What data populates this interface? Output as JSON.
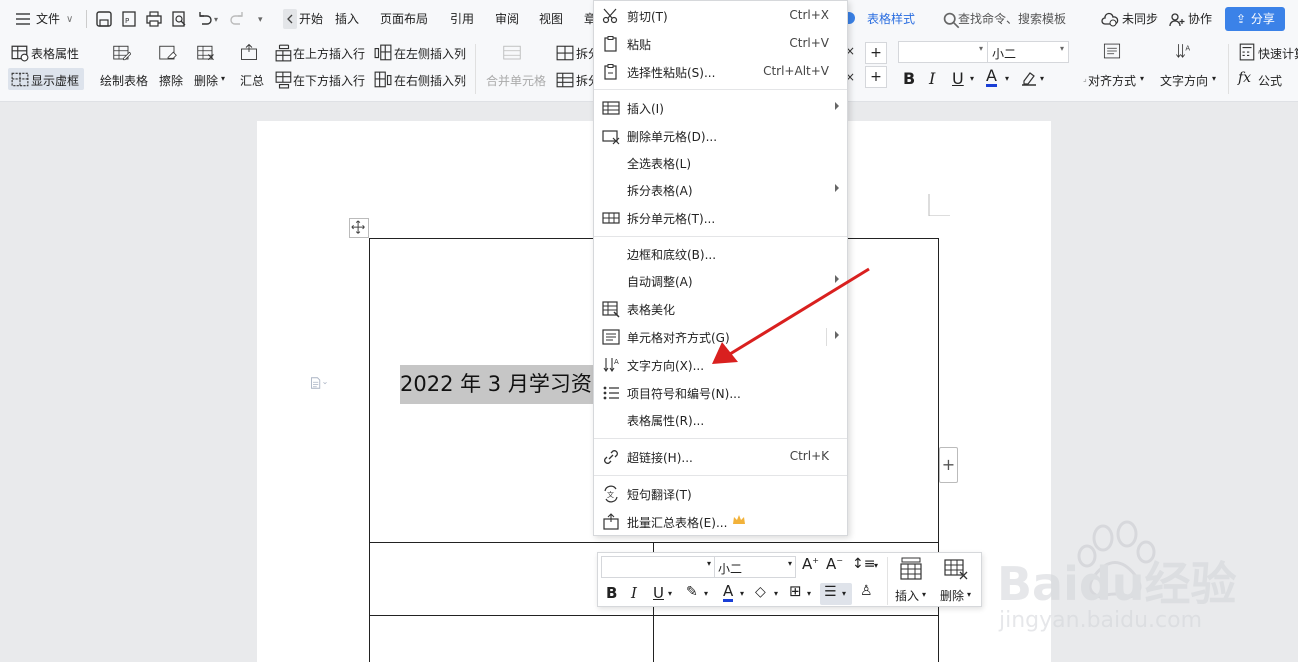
{
  "topbar": {
    "file_label": "文件",
    "tabs": [
      "开始",
      "插入",
      "页面布局",
      "引用",
      "审阅",
      "视图",
      "章"
    ],
    "active_tab": "表格样式",
    "search_placeholder": "查找命令、搜索模板",
    "sync_label": "未同步",
    "collab_label": "协作",
    "share_label": "分享"
  },
  "ribbon": {
    "table_props": "表格属性",
    "show_gridlines": "显示虚框",
    "draw_table": "绘制表格",
    "erase": "擦除",
    "delete": "删除",
    "summary": "汇总",
    "insert_above": "在上方插入行",
    "insert_below": "在下方插入行",
    "insert_left": "在左侧插入列",
    "insert_right": "在右侧插入列",
    "merge_cells": "合并单元格",
    "split_1": "拆分",
    "split_2": "拆分",
    "font_size": "小二",
    "align": "对齐方式",
    "text_dir": "文字方向",
    "quick_calc": "快速计算",
    "formula": "公式"
  },
  "document": {
    "cell_text": "2022 年 3 月学习资"
  },
  "context_menu": {
    "items": [
      {
        "label": "剪切(T)",
        "shortcut": "Ctrl+X",
        "icon": "scissors-icon"
      },
      {
        "label": "粘贴",
        "shortcut": "Ctrl+V",
        "icon": "paste-icon"
      },
      {
        "label": "选择性粘贴(S)...",
        "shortcut": "Ctrl+Alt+V",
        "icon": "paste-special-icon"
      },
      {
        "label": "插入(I)",
        "shortcut": "",
        "icon": "table-insert-icon"
      },
      {
        "label": "删除单元格(D)...",
        "shortcut": "",
        "icon": "delete-cell-icon"
      },
      {
        "label": "全选表格(L)",
        "shortcut": "",
        "icon": ""
      },
      {
        "label": "拆分表格(A)",
        "shortcut": "",
        "icon": ""
      },
      {
        "label": "拆分单元格(T)...",
        "shortcut": "",
        "icon": "split-cell-icon"
      },
      {
        "label": "边框和底纹(B)...",
        "shortcut": "",
        "icon": ""
      },
      {
        "label": "自动调整(A)",
        "shortcut": "",
        "icon": ""
      },
      {
        "label": "表格美化",
        "shortcut": "",
        "icon": "table-style-icon"
      },
      {
        "label": "单元格对齐方式(G)",
        "shortcut": "",
        "icon": "cell-align-icon"
      },
      {
        "label": "文字方向(X)...",
        "shortcut": "",
        "icon": "text-direction-icon"
      },
      {
        "label": "项目符号和编号(N)...",
        "shortcut": "",
        "icon": "bullet-list-icon"
      },
      {
        "label": "表格属性(R)...",
        "shortcut": "",
        "icon": ""
      },
      {
        "label": "超链接(H)...",
        "shortcut": "Ctrl+K",
        "icon": "link-icon"
      },
      {
        "label": "短句翻译(T)",
        "shortcut": "",
        "icon": "translate-icon"
      },
      {
        "label": "批量汇总表格(E)...",
        "shortcut": "",
        "icon": "batch-summary-icon"
      }
    ]
  },
  "mini_toolbar": {
    "font_size": "小二",
    "insert_label": "插入",
    "delete_label": "删除"
  },
  "watermark": {
    "brand": "Baidu经验",
    "url": "jingyan.baidu.com"
  },
  "colors": {
    "accent": "#3b82e8",
    "arrow": "#d9201f",
    "font_color": "#1a3fd6"
  }
}
